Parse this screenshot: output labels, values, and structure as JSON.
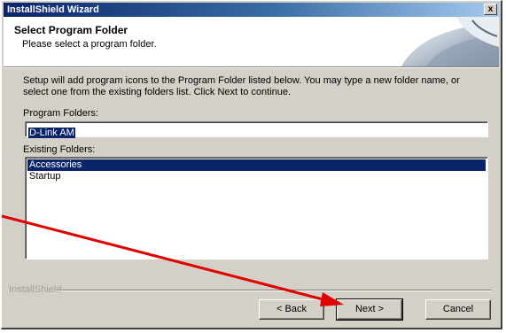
{
  "window": {
    "title": "InstallShield Wizard",
    "close_label": "x"
  },
  "header": {
    "title": "Select Program Folder",
    "subtitle": "Please select a program folder."
  },
  "instructions": "Setup will add program icons to the Program Folder listed below.  You may type a new folder name, or select one from the existing folders list.  Click Next to continue.",
  "program_folder": {
    "label": "Program Folders:",
    "value": "D-Link AM"
  },
  "existing_folders": {
    "label": "Existing Folders:",
    "items": [
      {
        "label": "Accessories",
        "selected": true
      },
      {
        "label": "Startup",
        "selected": false
      }
    ]
  },
  "footer": {
    "brand": "InstallShield",
    "back_label": "< Back",
    "next_label": "Next >",
    "cancel_label": "Cancel"
  },
  "annotation": {
    "arrow_color": "#e00000"
  }
}
